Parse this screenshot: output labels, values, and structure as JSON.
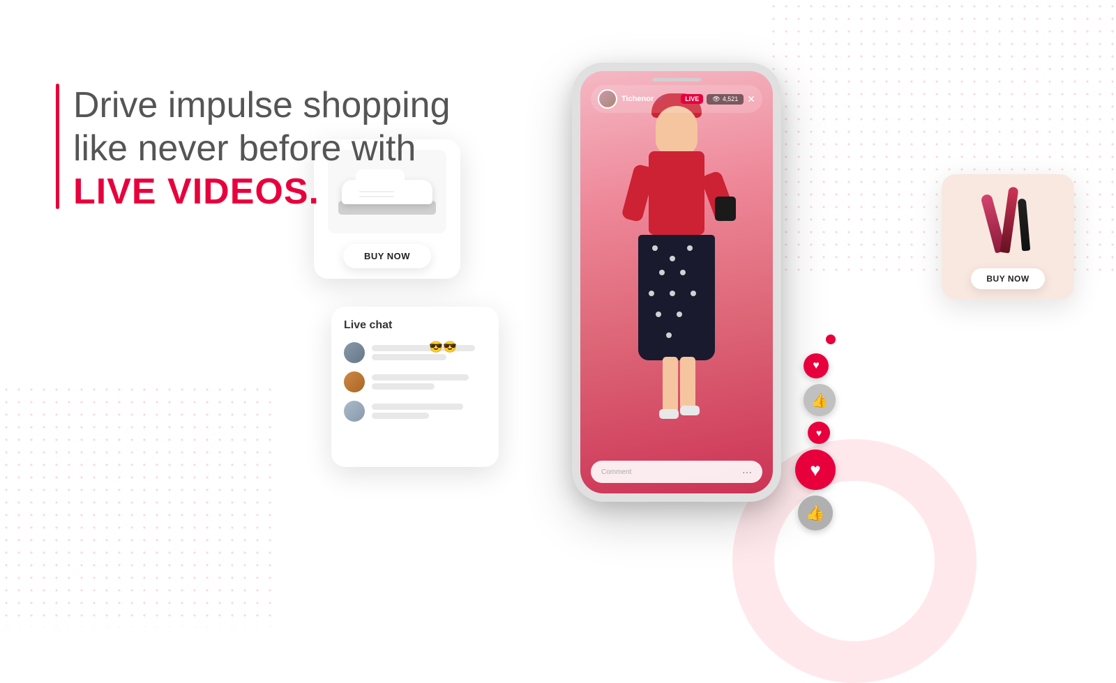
{
  "page": {
    "background_color": "#ffffff"
  },
  "headline": {
    "line1": "Drive impulse shopping",
    "line2": "like never before with",
    "line3": "LIVE VIDEOS."
  },
  "accent_bar": {
    "color": "#e8003d"
  },
  "phone": {
    "username": "Tichenor",
    "live_badge": "LIVE",
    "viewers": "4,521",
    "comment_placeholder": "Comment",
    "close": "✕"
  },
  "product_cards": {
    "left": {
      "buy_label": "BUY NOW",
      "product": "sneakers"
    },
    "right": {
      "buy_label": "BUY NOW",
      "product": "cosmetics"
    }
  },
  "live_chat": {
    "title": "Live chat",
    "messages": [
      {
        "id": 1,
        "avatar_class": "avatar-1"
      },
      {
        "id": 2,
        "avatar_class": "avatar-2"
      },
      {
        "id": 3,
        "avatar_class": "avatar-3"
      }
    ]
  },
  "reactions": {
    "heart": "♥",
    "thumbs_up": "👍"
  },
  "emojis": {
    "sunglasses": "😎😎"
  }
}
